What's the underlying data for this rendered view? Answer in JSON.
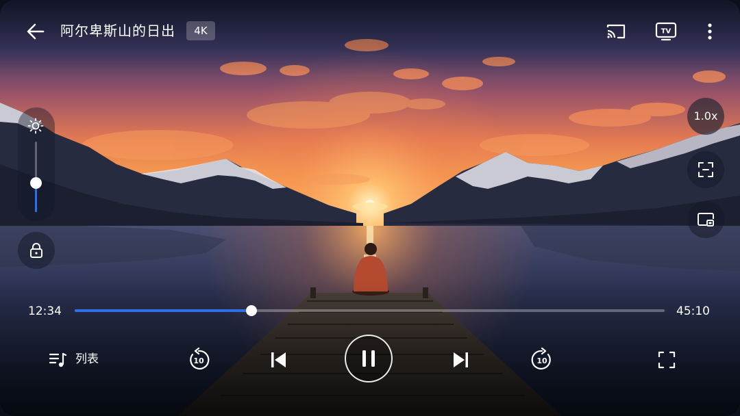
{
  "video": {
    "title": "阿尔卑斯山的日出",
    "quality_badge": "4K"
  },
  "top_actions": {
    "icons": [
      "back-arrow-icon",
      "cast-icon",
      "tv-icon",
      "more-vertical-icon"
    ]
  },
  "side_controls": {
    "brightness_level": 0.42,
    "speed_label": "1.0x",
    "icons": [
      "sun-icon",
      "lock-icon",
      "screenshot-icon",
      "picture-in-picture-icon"
    ]
  },
  "progress": {
    "elapsed": "12:34",
    "total": "45:10",
    "fraction": 0.3
  },
  "bottom_controls": {
    "playlist_label": "列表",
    "rewind_seconds": "10",
    "forward_seconds": "10",
    "state": "playing"
  },
  "colors": {
    "accent": "#2f6fe8",
    "text": "#ffffff"
  }
}
